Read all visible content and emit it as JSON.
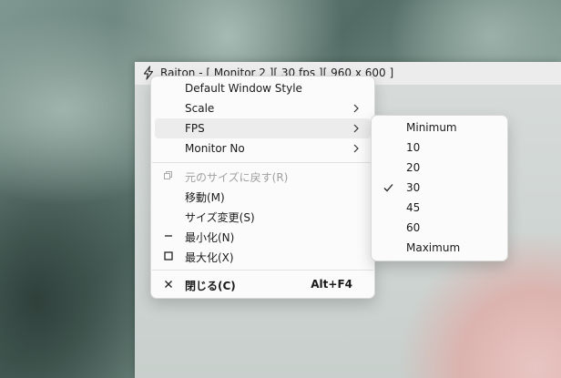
{
  "window": {
    "title": "Raiton - [ Monitor 2 ][ 30 fps ][ 960 x 600 ]"
  },
  "system_menu": {
    "items": [
      {
        "label": "Default Window Style"
      },
      {
        "label": "Scale"
      },
      {
        "label": "FPS"
      },
      {
        "label": "Monitor No"
      },
      {
        "label": "元のサイズに戻す(R)"
      },
      {
        "label": "移動(M)"
      },
      {
        "label": "サイズ変更(S)"
      },
      {
        "label": "最小化(N)"
      },
      {
        "label": "最大化(X)"
      },
      {
        "label": "閉じる(C)",
        "accelerator": "Alt+F4"
      }
    ],
    "highlighted_item": "FPS",
    "disabled_items": [
      "元のサイズに戻す(R)"
    ]
  },
  "fps_submenu": {
    "items": [
      {
        "label": "Minimum"
      },
      {
        "label": "10"
      },
      {
        "label": "20"
      },
      {
        "label": "30"
      },
      {
        "label": "45"
      },
      {
        "label": "60"
      },
      {
        "label": "Maximum"
      }
    ],
    "checked_item": "30"
  },
  "icons": {
    "app": "lightning-bolt-icon",
    "submenu_arrow": "chevron-right-icon",
    "restore": "restore-icon",
    "minimize": "minimize-icon",
    "maximize": "maximize-icon",
    "close": "close-icon",
    "checked": "checkmark-icon"
  }
}
